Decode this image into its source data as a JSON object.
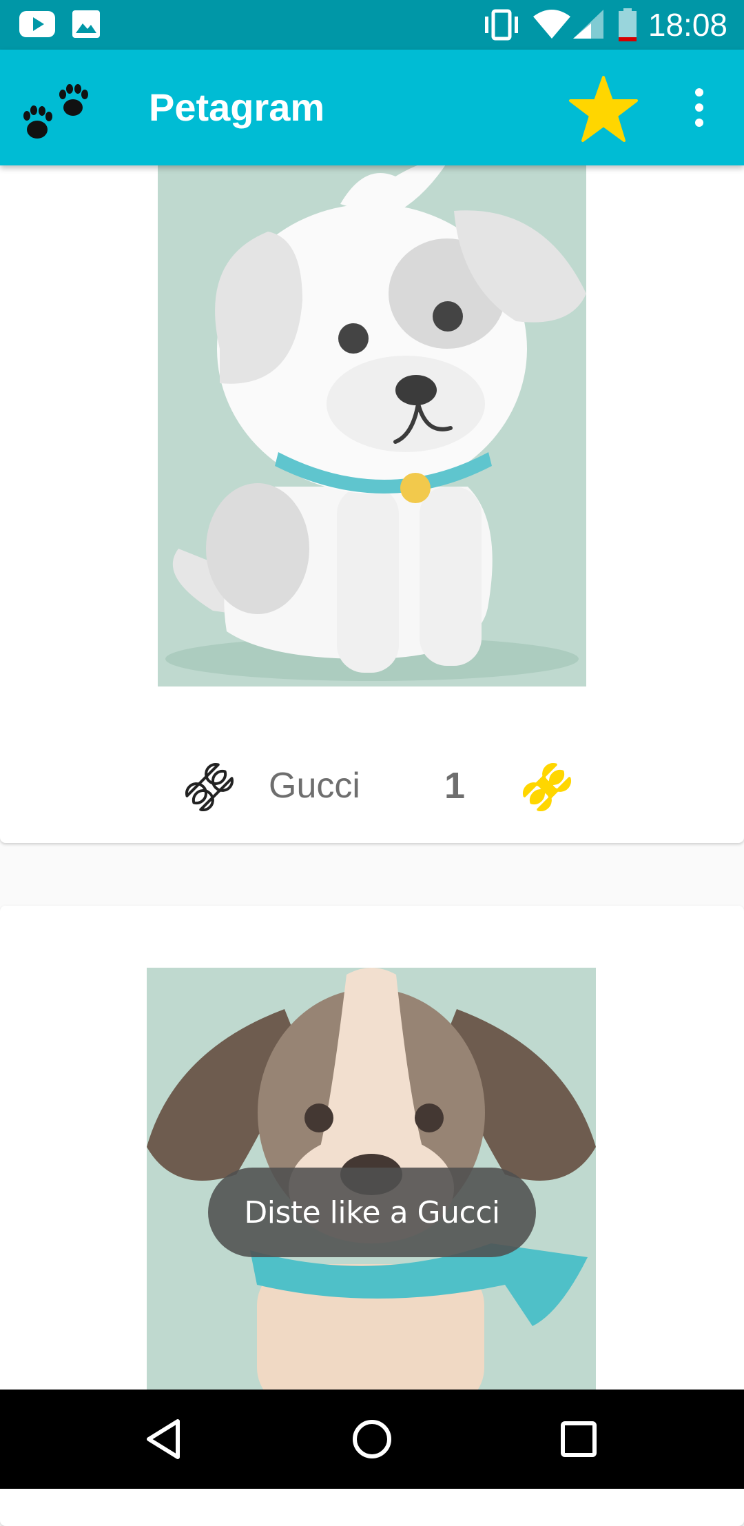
{
  "status_bar": {
    "time": "18:08",
    "icons": [
      "youtube-icon",
      "image-icon",
      "vibrate-icon",
      "wifi-icon",
      "signal-icon",
      "battery-low-icon"
    ]
  },
  "app_bar": {
    "title": "Petagram",
    "logo_icon": "paw-prints-icon",
    "action_icons": [
      "star-icon",
      "more-vert-icon"
    ],
    "accent": "#00bcd4",
    "status_color": "#0097a7",
    "star_color": "#ffd600"
  },
  "pets": [
    {
      "name": "Gucci",
      "likes": "1",
      "image": "white-puppy-illustration"
    },
    {
      "name": "",
      "likes": "",
      "image": "brown-beagle-illustration"
    }
  ],
  "toast": {
    "text": "Diste like a Gucci"
  },
  "nav_bar": {
    "icons": [
      "back-icon",
      "home-icon",
      "recents-icon"
    ]
  }
}
